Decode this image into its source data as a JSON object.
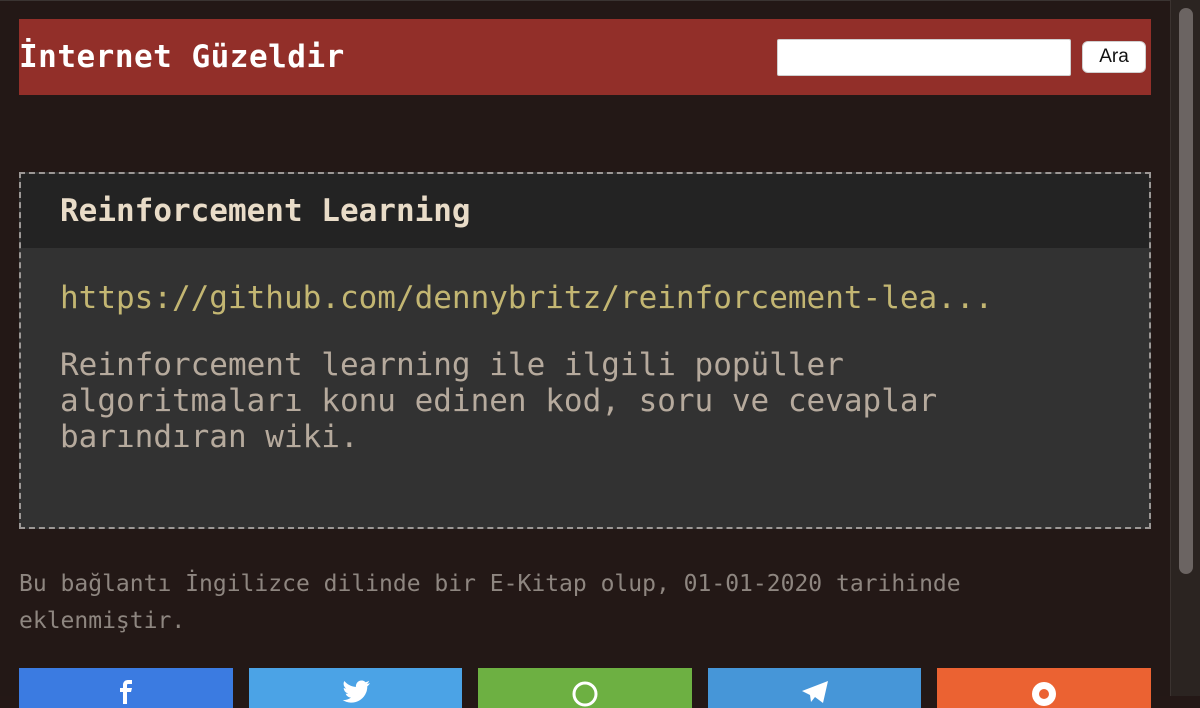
{
  "header": {
    "site_title": "İnternet Güzeldir",
    "search_placeholder": "",
    "search_value": "",
    "search_button_label": "Ara"
  },
  "card": {
    "title": "Reinforcement Learning",
    "link_text": "https://github.com/dennybritz/reinforcement-lea...",
    "description": "Reinforcement learning ile ilgili popüller algoritmaları konu edinen kod, soru ve cevaplar barındıran wiki."
  },
  "meta": {
    "text": "Bu bağlantı İngilizce dilinde bir E-Kitap olup, 01-01-2020 tarihinde eklenmiştir."
  },
  "share": [
    {
      "name": "facebook",
      "icon": "facebook-icon",
      "color": "#3b7be1"
    },
    {
      "name": "twitter",
      "icon": "twitter-icon",
      "color": "#4ba3e6"
    },
    {
      "name": "whatsapp",
      "icon": "whatsapp-icon",
      "color": "#6db042"
    },
    {
      "name": "telegram",
      "icon": "telegram-icon",
      "color": "#4696d8"
    },
    {
      "name": "reddit",
      "icon": "reddit-icon",
      "color": "#eb6232"
    }
  ],
  "colors": {
    "header_bg": "#922f29",
    "page_bg": "#231816",
    "card_bg": "#323232",
    "card_header_bg": "#232323",
    "link": "#c3b672",
    "body_text": "#b6aa9d"
  }
}
